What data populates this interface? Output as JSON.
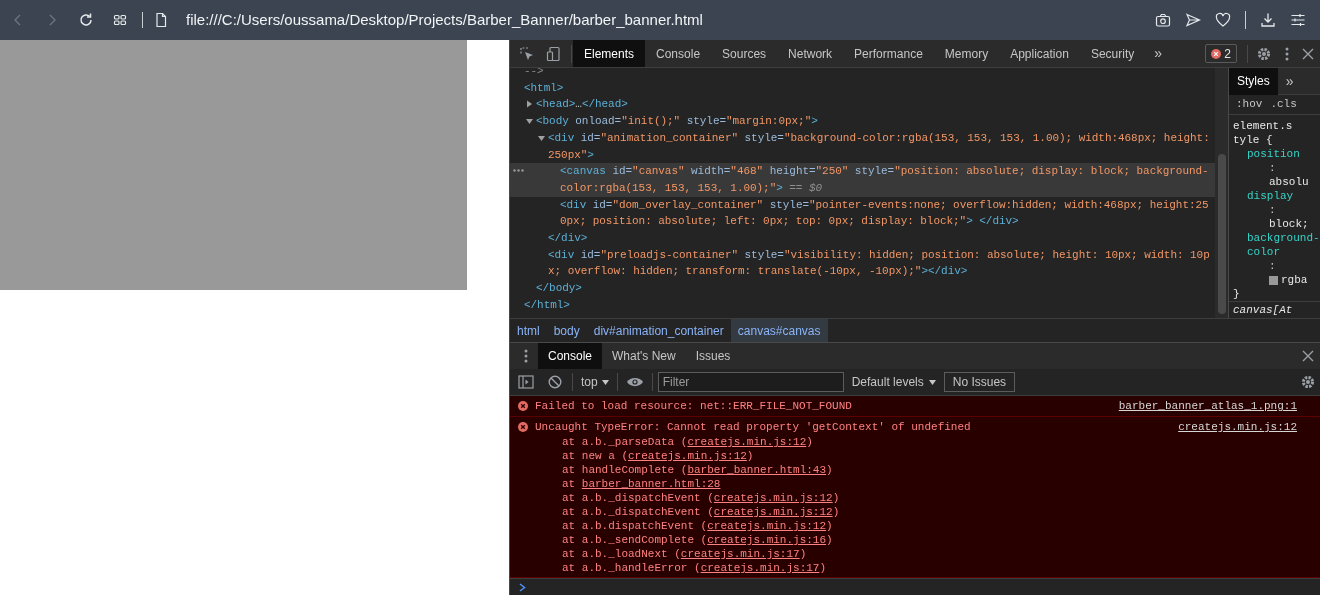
{
  "browser": {
    "nav_buttons": [
      {
        "kind": "back",
        "disabled": true
      },
      {
        "kind": "forward",
        "disabled": true
      },
      {
        "kind": "reload",
        "disabled": false
      },
      {
        "kind": "tabs",
        "disabled": false
      }
    ],
    "url": "file:///C:/Users/oussama/Desktop/Projects/Barber_Banner/barber_banner.html",
    "actions": [
      {
        "kind": "camera"
      },
      {
        "kind": "send"
      },
      {
        "kind": "heart"
      },
      {
        "kind": "divider"
      },
      {
        "kind": "download"
      },
      {
        "kind": "settings"
      }
    ]
  },
  "devtools": {
    "tabs": [
      {
        "label": "Elements",
        "selected": true
      },
      {
        "label": "Console",
        "selected": false
      },
      {
        "label": "Sources",
        "selected": false
      },
      {
        "label": "Network",
        "selected": false
      },
      {
        "label": "Performance",
        "selected": false
      },
      {
        "label": "Memory",
        "selected": false
      },
      {
        "label": "Application",
        "selected": false
      },
      {
        "label": "Security",
        "selected": false
      }
    ],
    "more_tabs": "»",
    "error_count": "2",
    "dom_tree": [
      {
        "selected": false,
        "open": [
          {
            "kind": "comment",
            "text": "-->"
          }
        ]
      },
      {
        "selected": false,
        "open": [
          {
            "kind": "tag",
            "text": "<html>"
          }
        ],
        "close": [
          {
            "kind": "tag",
            "text": "</html>"
          }
        ],
        "children": [
          {
            "selected": false,
            "expanded": false,
            "open": [
              {
                "kind": "tag",
                "text": "<head>"
              },
              {
                "kind": "plain",
                "text": "…"
              },
              {
                "kind": "tag",
                "text": "</head>"
              }
            ]
          },
          {
            "selected": false,
            "expanded": true,
            "open": [
              {
                "kind": "tag",
                "text": "<body"
              },
              {
                "kind": "attr",
                "text": " onload="
              },
              {
                "kind": "value",
                "text": "\"init();\""
              },
              {
                "kind": "attr",
                "text": " style="
              },
              {
                "kind": "value",
                "text": "\"margin:0px;\""
              },
              {
                "kind": "tag",
                "text": ">"
              }
            ],
            "close": [
              {
                "kind": "tag",
                "text": "</body>"
              }
            ],
            "children": [
              {
                "selected": false,
                "expanded": true,
                "open": [
                  {
                    "kind": "tag",
                    "text": "<div"
                  },
                  {
                    "kind": "attr",
                    "text": " id="
                  },
                  {
                    "kind": "value",
                    "text": "\"animation_container\""
                  },
                  {
                    "kind": "attr",
                    "text": " style="
                  },
                  {
                    "kind": "value",
                    "text": "\"background-color:rgba(153, 153, 153, 1.00); width:468px; height:250px\""
                  },
                  {
                    "kind": "tag",
                    "text": ">"
                  }
                ],
                "close": [
                  {
                    "kind": "tag",
                    "text": "</div>"
                  }
                ],
                "children": [
                  {
                    "selected": true,
                    "open": [
                      {
                        "kind": "tag",
                        "text": "<canvas"
                      },
                      {
                        "kind": "attr",
                        "text": " id="
                      },
                      {
                        "kind": "value",
                        "text": "\"canvas\""
                      },
                      {
                        "kind": "attr",
                        "text": " width="
                      },
                      {
                        "kind": "value",
                        "text": "\"468\""
                      },
                      {
                        "kind": "attr",
                        "text": " height="
                      },
                      {
                        "kind": "value",
                        "text": "\"250\""
                      },
                      {
                        "kind": "attr",
                        "text": " style="
                      },
                      {
                        "kind": "value",
                        "text": "\"position: absolute; display: block; background-color:rgba(153, 153, 153, 1.00);\""
                      },
                      {
                        "kind": "tag",
                        "text": ">"
                      },
                      {
                        "kind": "ref",
                        "text": " == $0"
                      }
                    ]
                  },
                  {
                    "selected": false,
                    "open": [
                      {
                        "kind": "tag",
                        "text": "<div"
                      },
                      {
                        "kind": "attr",
                        "text": " id="
                      },
                      {
                        "kind": "value",
                        "text": "\"dom_overlay_container\""
                      },
                      {
                        "kind": "attr",
                        "text": " style="
                      },
                      {
                        "kind": "value",
                        "text": "\"pointer-events:none; overflow:hidden; width:468px; height:250px; position: absolute; left: 0px; top: 0px; display: block;\""
                      },
                      {
                        "kind": "tag",
                        "text": ">"
                      },
                      {
                        "kind": "tag",
                        "text": " </div>"
                      }
                    ]
                  }
                ]
              },
              {
                "selected": false,
                "open": [
                  {
                    "kind": "tag",
                    "text": "<div"
                  },
                  {
                    "kind": "attr",
                    "text": " id="
                  },
                  {
                    "kind": "value",
                    "text": "\"preloadjs-container\""
                  },
                  {
                    "kind": "attr",
                    "text": " style="
                  },
                  {
                    "kind": "value",
                    "text": "\"visibility: hidden; position: absolute; height: 10px; width: 10px; overflow: hidden; transform: translate(-10px, -10px);\""
                  },
                  {
                    "kind": "tag",
                    "text": "></div>"
                  }
                ]
              }
            ]
          }
        ]
      }
    ],
    "styles": {
      "tabs": [
        {
          "label": "Styles",
          "selected": true
        }
      ],
      "more": "»",
      "filters": [
        ":hov",
        ".cls"
      ],
      "selector": "element.style {",
      "declarations": [
        {
          "property": "position",
          "colon": ":",
          "value": "absolu"
        },
        {
          "property": "display",
          "colon": ":",
          "value": "block;"
        },
        {
          "property": "background-color",
          "colon": ":",
          "value": "rgba",
          "color": "#999999"
        }
      ],
      "close": "}",
      "next_selector": "canvas[At"
    },
    "breadcrumbs": [
      {
        "label": "html",
        "selected": false
      },
      {
        "label": "body",
        "selected": false
      },
      {
        "label": "div#animation_container",
        "selected": false
      },
      {
        "label": "canvas#canvas",
        "selected": true
      }
    ],
    "drawer_tabs": [
      {
        "label": "Console",
        "selected": true
      },
      {
        "label": "What's New",
        "selected": false
      },
      {
        "label": "Issues",
        "selected": false
      }
    ],
    "console_toolbar": {
      "context": "top",
      "filter_placeholder": "Filter",
      "levels": "Default levels",
      "issues": "No Issues"
    },
    "messages": [
      {
        "kind": "error",
        "text": "Failed to load resource: net::ERR_FILE_NOT_FOUND",
        "source": "barber_banner_atlas_1.png:1"
      },
      {
        "kind": "error",
        "text": "Uncaught TypeError: Cannot read property 'getContext' of undefined",
        "source": "createjs.min.js:12",
        "stack": [
          {
            "before": "at a.b._parseData (",
            "link": "createjs.min.js:12",
            "after": ")"
          },
          {
            "before": "at new a (",
            "link": "createjs.min.js:12",
            "after": ")"
          },
          {
            "before": "at handleComplete (",
            "link": "barber_banner.html:43",
            "after": ")"
          },
          {
            "before": "at ",
            "link": "barber_banner.html:28"
          },
          {
            "before": "at a.b._dispatchEvent (",
            "link": "createjs.min.js:12",
            "after": ")"
          },
          {
            "before": "at a.b._dispatchEvent (",
            "link": "createjs.min.js:12",
            "after": ")"
          },
          {
            "before": "at a.b.dispatchEvent (",
            "link": "createjs.min.js:12",
            "after": ")"
          },
          {
            "before": "at a.b._sendComplete (",
            "link": "createjs.min.js:16",
            "after": ")"
          },
          {
            "before": "at a.b._loadNext (",
            "link": "createjs.min.js:17",
            "after": ")"
          },
          {
            "before": "at a.b._handleError (",
            "link": "createjs.min.js:17",
            "after": ")"
          }
        ]
      }
    ]
  }
}
